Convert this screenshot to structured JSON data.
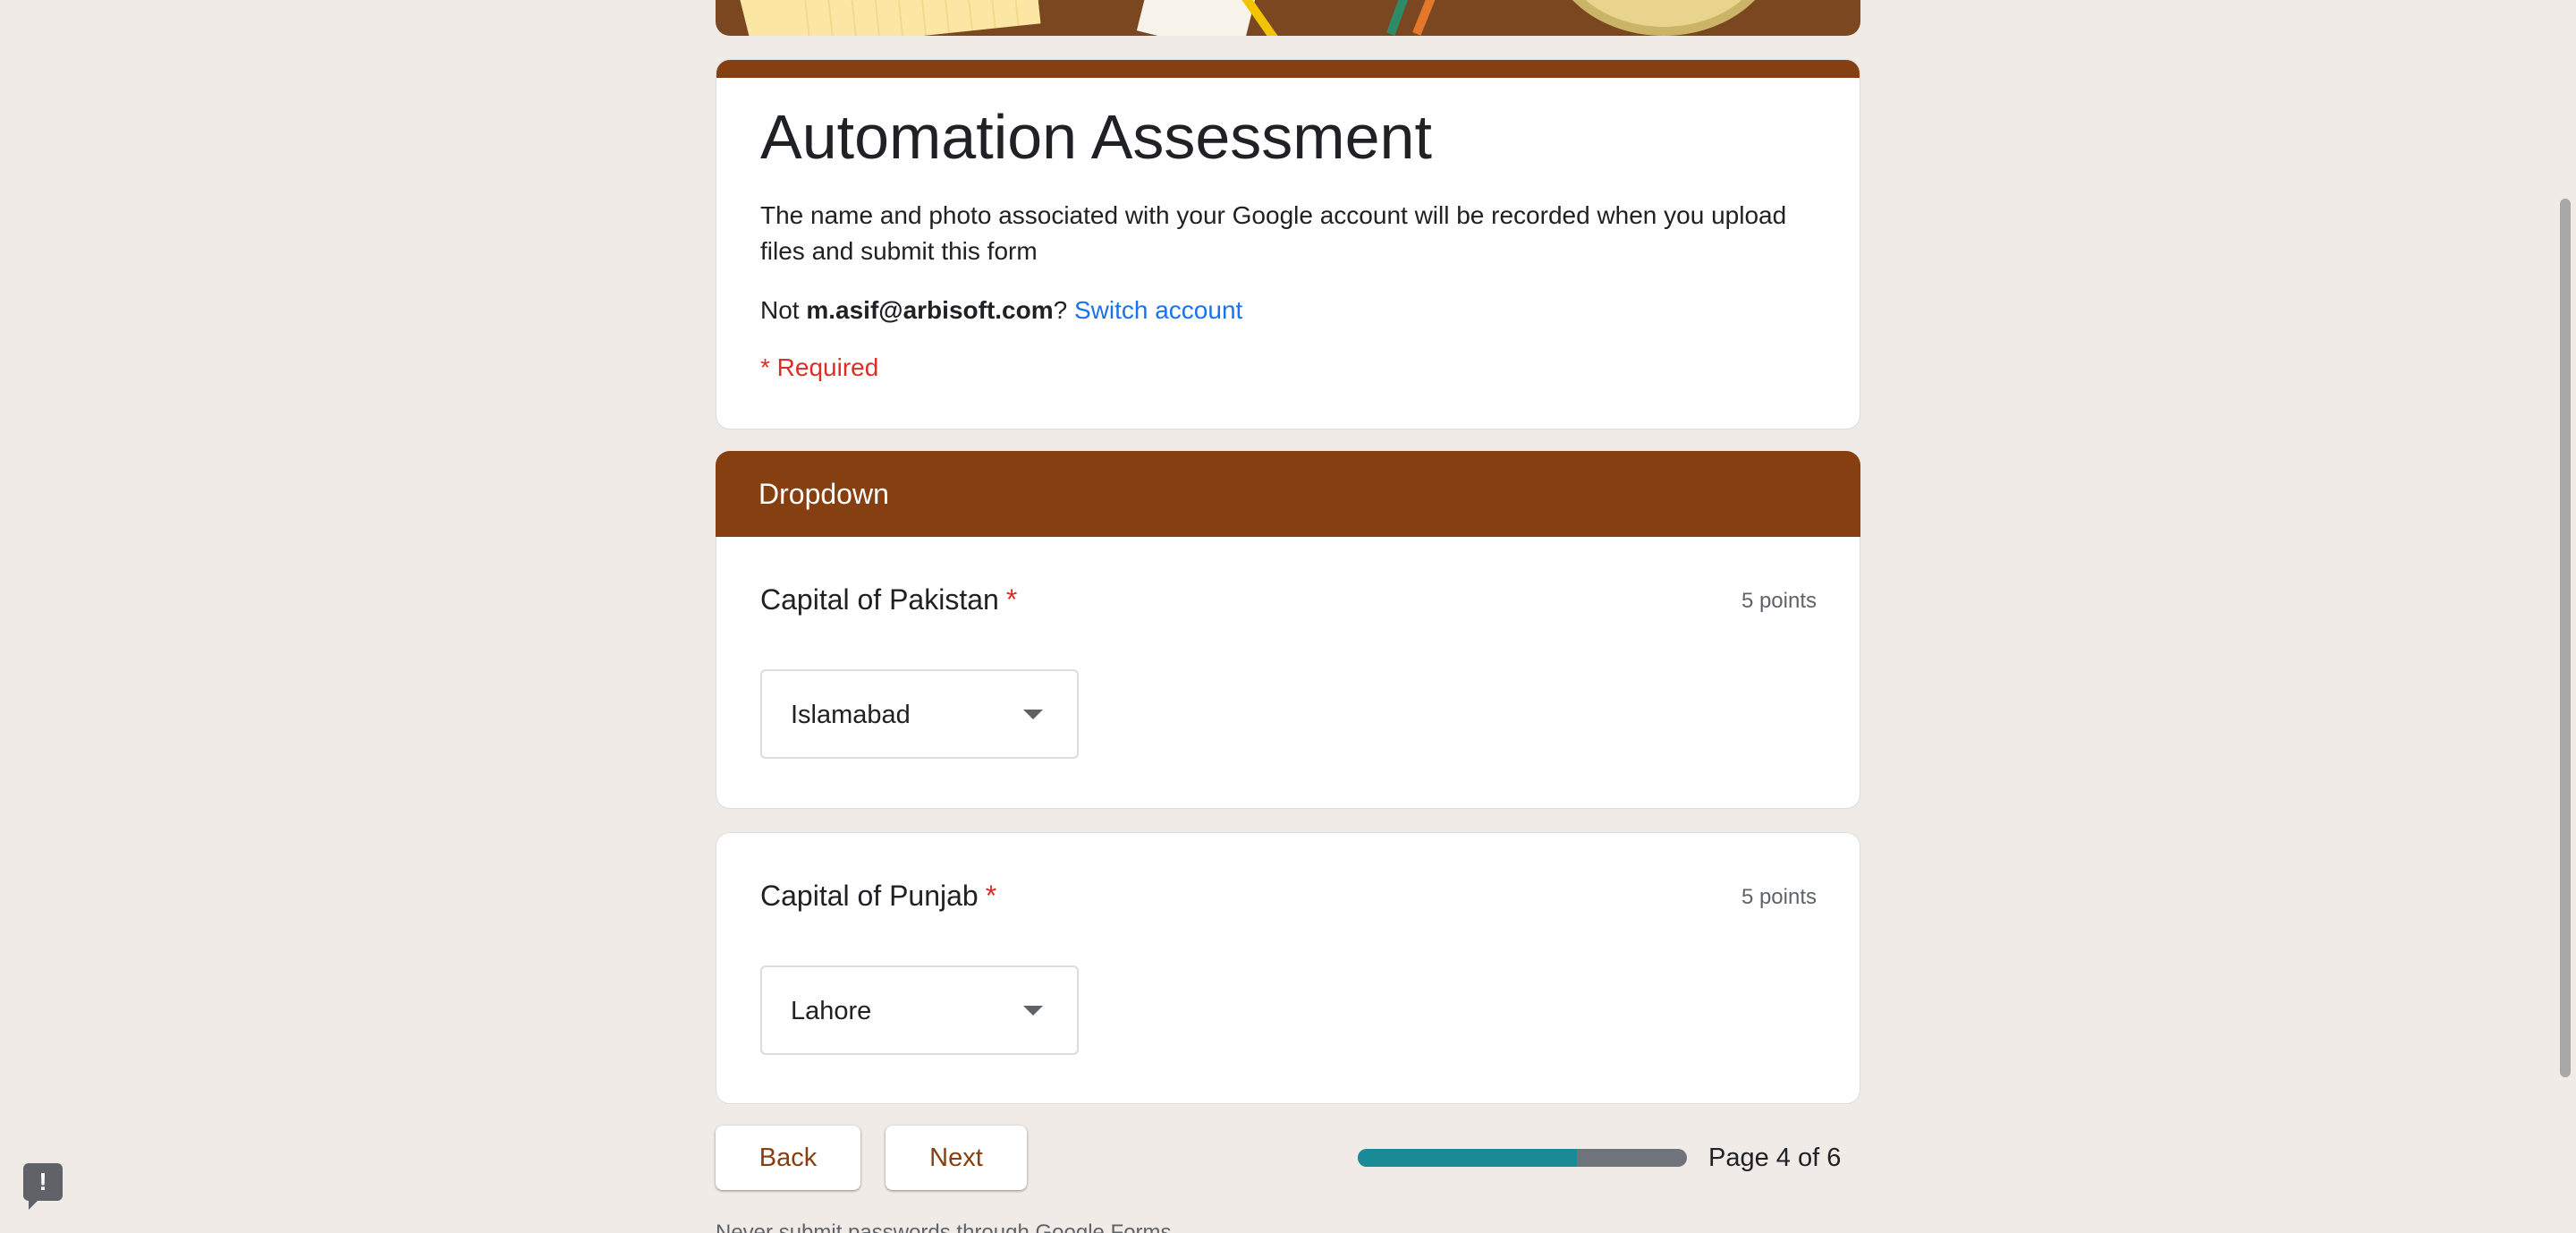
{
  "form": {
    "title": "Automation Assessment",
    "description": "The name and photo associated with your Google account will be recorded when you upload files and submit this form",
    "account_prefix": "Not",
    "account_email": "m.asif@arbisoft.com",
    "account_suffix": "?",
    "switch_account": "Switch account",
    "required_note": "* Required"
  },
  "section": {
    "title": "Dropdown"
  },
  "questions": [
    {
      "title": "Capital of Pakistan",
      "required_mark": "*",
      "points": "5 points",
      "selected": "Islamabad"
    },
    {
      "title": "Capital of Punjab",
      "required_mark": "*",
      "points": "5 points",
      "selected": "Lahore"
    }
  ],
  "navigation": {
    "back_label": "Back",
    "next_label": "Next",
    "page_label": "Page 4 of 6",
    "progress_fraction": 0.667
  },
  "footer": {
    "text": "Never submit passwords through Google Forms."
  },
  "feedback_icon_glyph": "!",
  "colors": {
    "theme": "#863f11",
    "background": "#f1ebe7",
    "link": "#1a73e8",
    "required": "#d93025",
    "progress_fill": "#1a8a96",
    "progress_track": "#6f737a"
  },
  "icons": [
    "dropdown-arrow-icon",
    "report-problem-icon"
  ]
}
